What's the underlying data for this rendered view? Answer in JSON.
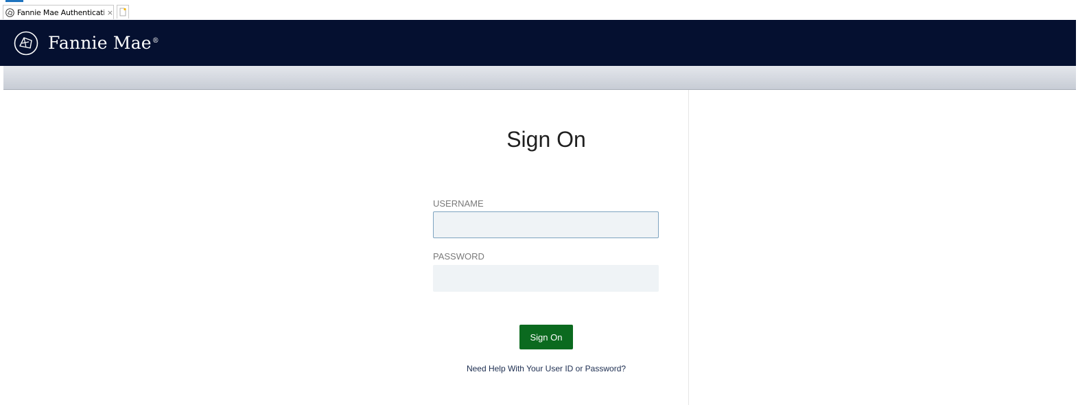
{
  "browser": {
    "tab_title": "Fannie Mae Authentication ...",
    "tab_close": "×",
    "tab_icon": "fannie-mae-logo-icon",
    "new_tab_icon": "new-tab-icon"
  },
  "header": {
    "brand": "Fannie Mae",
    "brand_mark": "®",
    "logo_icon": "fannie-mae-house-logo-icon",
    "background": "#051030"
  },
  "form": {
    "title": "Sign On",
    "username_label": "USERNAME",
    "username_value": "",
    "password_label": "PASSWORD",
    "password_value": "",
    "submit_label": "Sign On",
    "help_link": "Need Help With Your User ID or Password?",
    "button_color": "#0b6a1f"
  }
}
